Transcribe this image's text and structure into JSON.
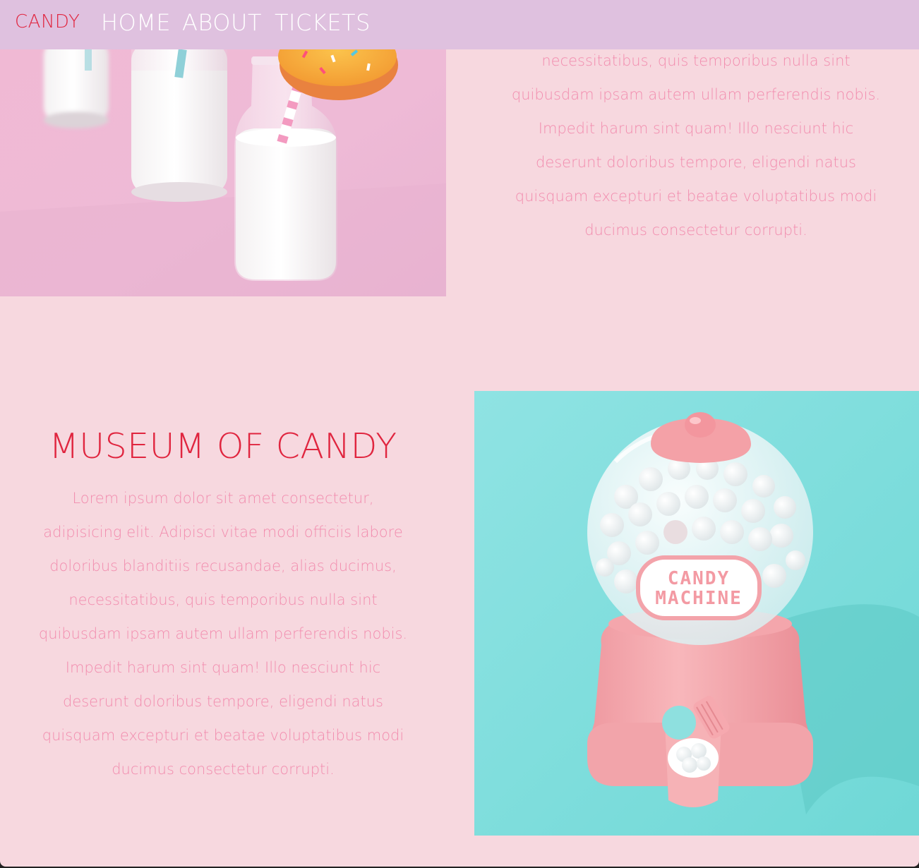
{
  "nav": {
    "brand": "CANDY",
    "links": [
      "HOME",
      "ABOUT",
      "TICKETS"
    ]
  },
  "intro": {
    "paragraph": "necessitatibus, quis temporibus nulla sint quibusdam ipsam autem ullam perferendis nobis. Impedit harum sint quam! Illo nesciunt hic deserunt doloribus tempore, eligendi natus quisquam excepturi et beatae voluptatibus modi ducimus consectetur corrupti.",
    "lines": [
      "necessitatibus, quis temporibus nulla sint",
      "quibusdam ipsam autem ullam perferendis nobis.",
      "Impedit harum sint quam! Illo nesciunt hic",
      "deserunt doloribus tempore, eligendi natus",
      "quisquam excepturi et beatae voluptatibus modi",
      "ducimus consectetur corrupti."
    ]
  },
  "museum": {
    "title": "MUSEUM OF CANDY",
    "lines": [
      "Lorem ipsum dolor sit amet consectetur,",
      "adipisicing elit. Adipisci vitae modi officiis labore",
      "doloribus blanditiis recusandae, alias ducimus,",
      "necessitatibus, quis temporibus nulla sint",
      "quibusdam ipsam autem ullam perferendis nobis.",
      "Impedit harum sint quam! Illo nesciunt hic",
      "deserunt doloribus tempore, eligendi natus",
      "quisquam excepturi et beatae voluptatibus modi",
      "ducimus consectetur corrupti."
    ],
    "machine_label_line1": "CANDY",
    "machine_label_line2": "MACHINE"
  },
  "colors": {
    "background": "#f7d8df",
    "navbar": "#dfc1df",
    "brand": "#e0253f",
    "body_text": "#f28cae",
    "nav_text": "#ffffff",
    "gumball_bg": "#7fdcdc",
    "gumball_pink": "#f4a3a8"
  }
}
